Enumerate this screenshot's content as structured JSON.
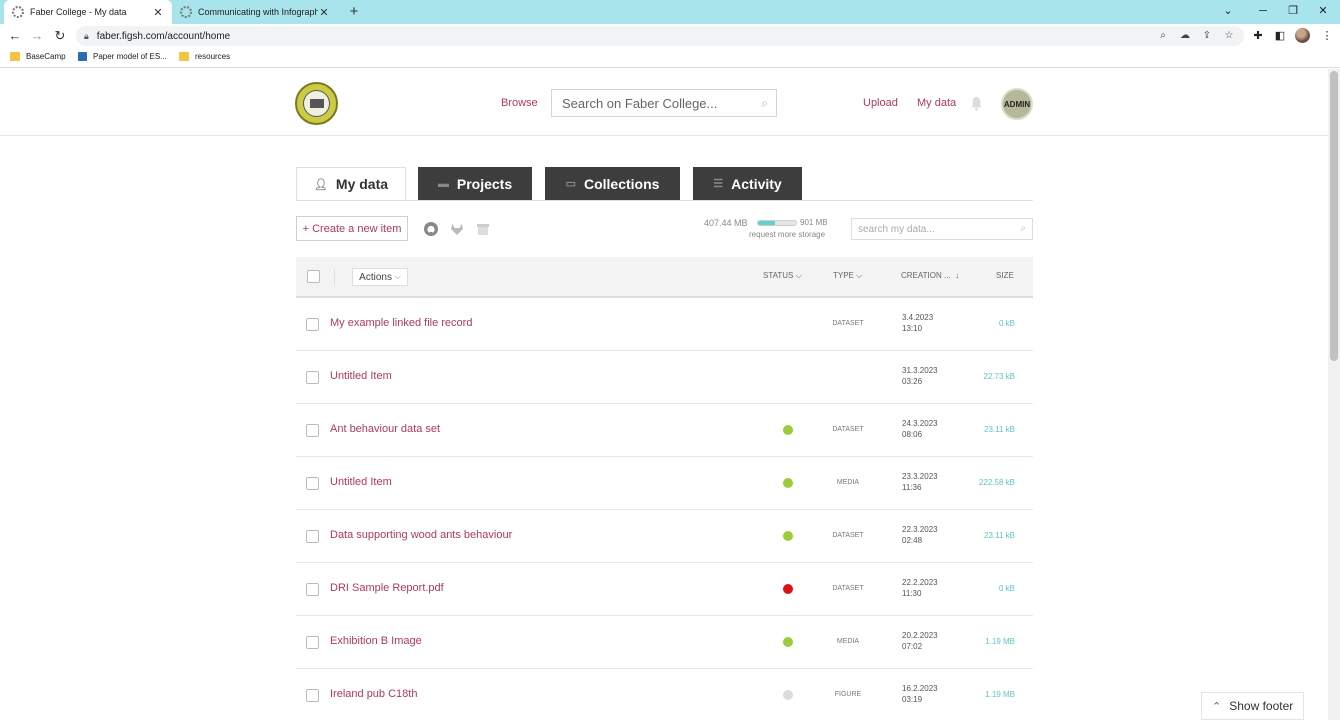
{
  "browser": {
    "tabs": [
      {
        "title": "Faber College - My data",
        "active": true
      },
      {
        "title": "Communicating with Infographic",
        "active": false
      }
    ],
    "url": "faber.figsh.com/account/home",
    "bookmarks": [
      "BaseCamp",
      "Paper model of ES...",
      "resources"
    ]
  },
  "header": {
    "browse": "Browse",
    "search_placeholder": "Search on Faber College...",
    "upload": "Upload",
    "my_data": "My data",
    "avatar_label": "ADMIN"
  },
  "tabs": [
    {
      "label": "My data",
      "icon": "user-icon",
      "active": true
    },
    {
      "label": "Projects",
      "icon": "folder-icon",
      "active": false
    },
    {
      "label": "Collections",
      "icon": "collection-icon",
      "active": false
    },
    {
      "label": "Activity",
      "icon": "list-icon",
      "active": false
    }
  ],
  "toolbar": {
    "create_label": "+ Create a new item",
    "storage_used": "407.44 MB",
    "storage_total": "901 MB",
    "storage_fraction": 0.452,
    "request_storage": "request more storage",
    "search_placeholder": "search my data..."
  },
  "table": {
    "actions": "Actions",
    "columns": {
      "status": "STATUS",
      "type": "TYPE",
      "creation": "CREATION ...",
      "size": "SIZE"
    },
    "rows": [
      {
        "title": "My example linked file record",
        "status": "none",
        "type": "DATASET",
        "date": "3.4.2023",
        "time": "13:10",
        "size": "0 kB"
      },
      {
        "title": "Untitled Item",
        "status": "none",
        "type": "",
        "date": "31.3.2023",
        "time": "03:26",
        "size": "22.73 kB"
      },
      {
        "title": "Ant behaviour data set",
        "status": "green",
        "type": "DATASET",
        "date": "24.3.2023",
        "time": "08:06",
        "size": "23.11 kB"
      },
      {
        "title": "Untitled Item",
        "status": "green",
        "type": "MEDIA",
        "date": "23.3.2023",
        "time": "11:36",
        "size": "222.58 kB"
      },
      {
        "title": "Data supporting wood ants behaviour",
        "status": "green",
        "type": "DATASET",
        "date": "22.3.2023",
        "time": "02:48",
        "size": "23.11 kB"
      },
      {
        "title": "DRI Sample Report.pdf",
        "status": "red",
        "type": "DATASET",
        "date": "22.2.2023",
        "time": "11:30",
        "size": "0 kB"
      },
      {
        "title": "Exhibition B Image",
        "status": "green",
        "type": "MEDIA",
        "date": "20.2.2023",
        "time": "07:02",
        "size": "1.19 MB"
      },
      {
        "title": "Ireland pub C18th",
        "status": "grey",
        "type": "FIGURE",
        "date": "16.2.2023",
        "time": "03:19",
        "size": "1.19 MB"
      }
    ]
  },
  "status_colors": {
    "green": "#9ccc3c",
    "red": "#dd1111",
    "grey": "#dcdcdc"
  },
  "footer_button": "Show footer"
}
